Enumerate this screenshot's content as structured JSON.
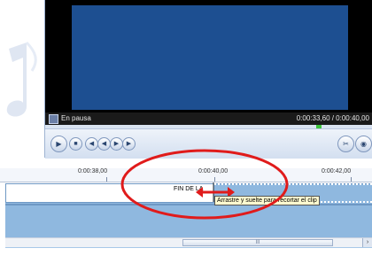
{
  "player": {
    "status": "En pausa",
    "time": "0:00:33,60 / 0:00:40,00",
    "controls": [
      "play",
      "stop",
      "previous",
      "rewind",
      "fast-forward",
      "next"
    ]
  },
  "timeline": {
    "ruler_labels": [
      "0:00:38,00",
      "0:00:40,00",
      "0:00:42,00"
    ],
    "clip_label": "FIN DE LA",
    "tooltip": "Arrastre y suelte para recortar el clip",
    "scroll_mark": "III"
  },
  "colors": {
    "video": "#1d4f91",
    "track": "#8fb8df",
    "highlight": "#e01b1b"
  }
}
